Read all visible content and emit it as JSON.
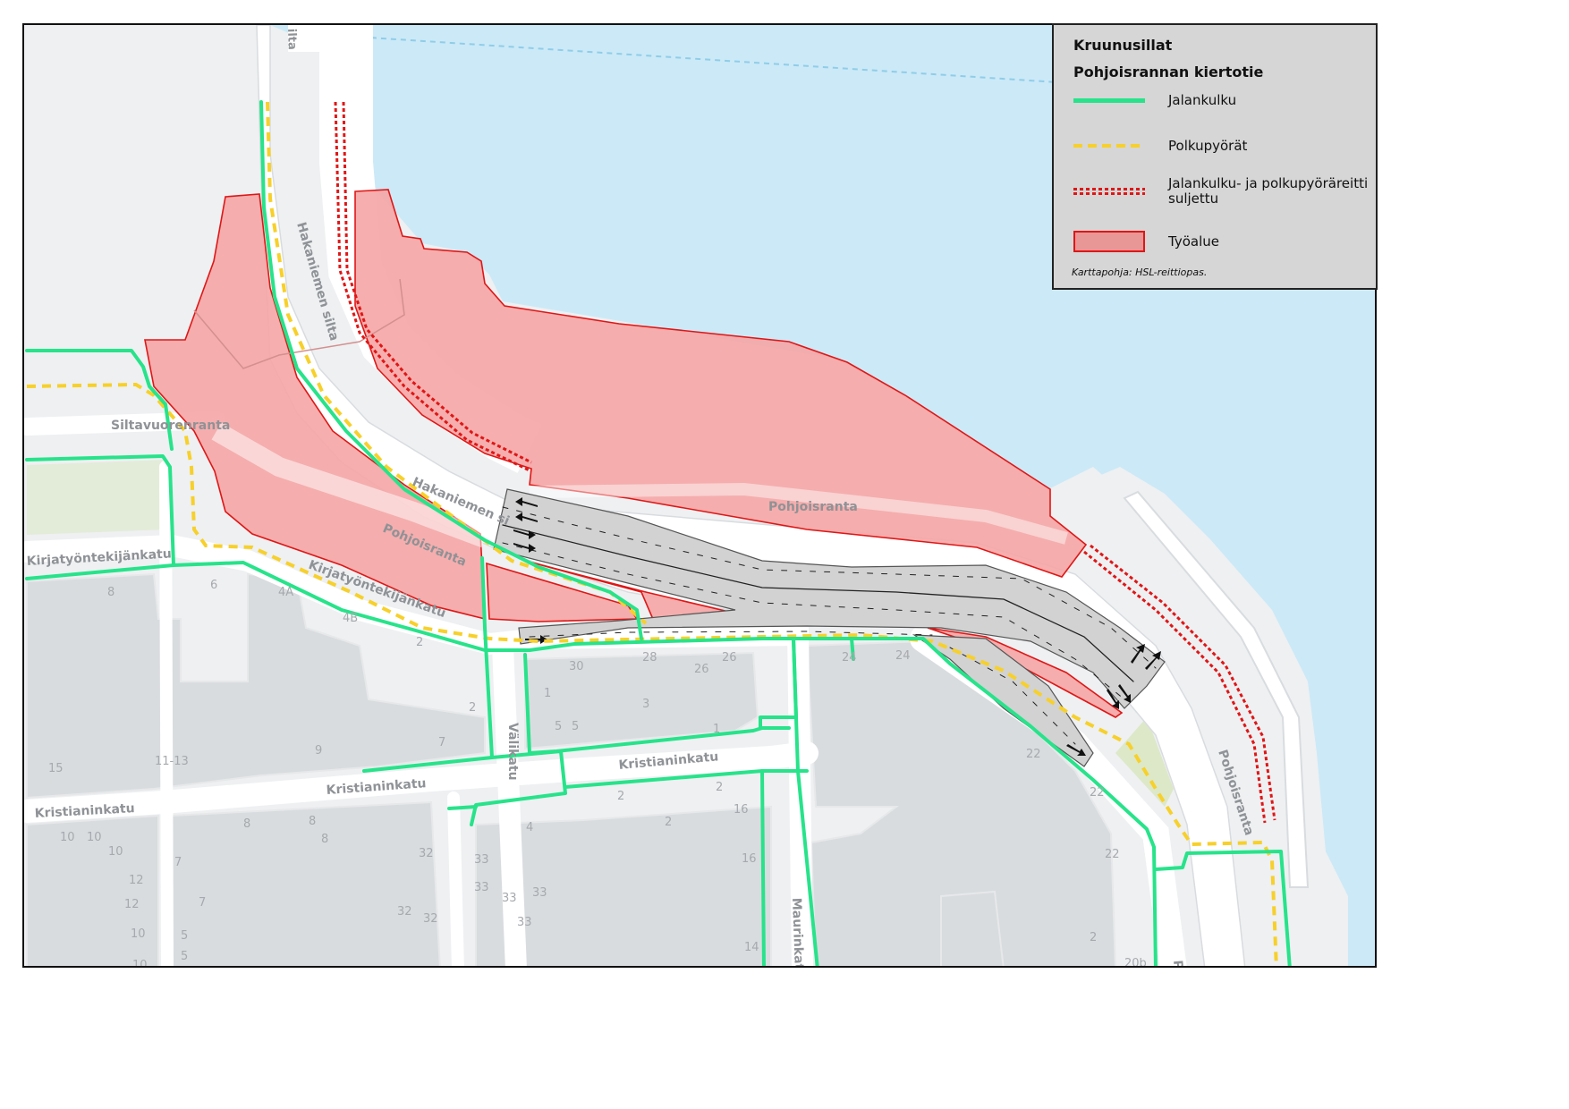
{
  "legend": {
    "title": "Kruunusillat",
    "subtitle": "Pohjoisrannan kiertotie",
    "items": [
      {
        "label": "Jalankulku",
        "color": "#27e38a",
        "style": "solid-line"
      },
      {
        "label": "Polkupyörät",
        "color": "#f7d02a",
        "style": "dashed-line"
      },
      {
        "label": "Jalankulku- ja polkupyöräreitti suljettu",
        "color": "#e01616",
        "style": "double-dotted-line"
      },
      {
        "label": "Työalue",
        "color": "#f0a0a0",
        "style": "filled-area"
      }
    ],
    "credit": "Karttapohja: HSL-reittiopas."
  },
  "map": {
    "colors": {
      "water": "#cce9f7",
      "land": "#eef0f2",
      "building": "#d9dcdf",
      "work_area": "#f5a5a5",
      "work_area_edge": "#e01616",
      "road": "#ffffff",
      "diversion_road": "#d2d2d2"
    },
    "streets": {
      "hakaniemen_silta_top": "ilta",
      "hakaniemen_silta": "Hakaniemen silta",
      "hakaniemen_silta_2": "Hakaniemen si",
      "siltavuorenranta": "Siltavuorenranta",
      "kirjatyontekijankatu_left": "Kirjatyöntekijänkatu",
      "kirjatyontekijankatu": "Kirjatyöntekijänkatu",
      "pohjoisranta_1": "Pohjoisranta",
      "pohjoisranta_2": "Pohjoisranta",
      "pohjoisranta_3": "Pohjoisranta",
      "pohjoisranta_4": "P",
      "valikatu": "Välikatu",
      "kristianinkatu_1": "Kristianinkatu",
      "kristianinkatu_2": "Kristianinkatu",
      "kristianinkatu_3": "Kristianinkatu",
      "maurinkatu": "Maurinkatu"
    },
    "house_numbers": [
      "8",
      "6",
      "4A",
      "4B",
      "2",
      "30",
      "28",
      "26",
      "26",
      "24",
      "24",
      "22",
      "1",
      "3",
      "5",
      "5",
      "1",
      "2",
      "7",
      "9",
      "11-13",
      "15",
      "22",
      "2",
      "2",
      "2",
      "16",
      "16",
      "22",
      "10",
      "10",
      "10",
      "8",
      "8",
      "8",
      "7",
      "7",
      "12",
      "12",
      "10",
      "10",
      "32",
      "32",
      "32",
      "33",
      "33",
      "33",
      "33",
      "33",
      "4",
      "5",
      "5",
      "14",
      "20b",
      "2"
    ]
  }
}
